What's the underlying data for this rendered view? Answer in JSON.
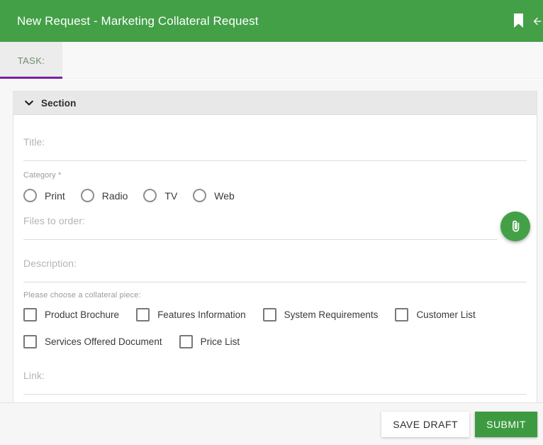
{
  "appbar": {
    "title": "New Request - Marketing Collateral Request",
    "background": "#43a047",
    "icons": [
      {
        "name": "bookmark-icon",
        "label": "Bookmark"
      },
      {
        "name": "back-arrow-icon",
        "label": "Back"
      }
    ]
  },
  "tabs": [
    {
      "label": "TASK:",
      "active": true,
      "accent": "#7b1fa2"
    }
  ],
  "section": {
    "title": "Section",
    "expanded": true,
    "chevron": "chevron-down-icon"
  },
  "fields": {
    "title": {
      "label": "Title:",
      "value": ""
    },
    "category": {
      "label": "Category *",
      "required": true,
      "options": [
        "Print",
        "Radio",
        "TV",
        "Web"
      ],
      "selected": ""
    },
    "files_to_order": {
      "label": "Files to order:",
      "value": ""
    },
    "description": {
      "label": "Description:",
      "value": ""
    },
    "collateral": {
      "label": "Please choose a collateral piece:",
      "row1": [
        "Product Brochure",
        "Features Information",
        "System Requirements",
        "Customer List"
      ],
      "row2": [
        "Services Offered Document",
        "Price List"
      ],
      "checked": []
    },
    "link": {
      "label": "Link:",
      "value": ""
    }
  },
  "attach": {
    "name": "attachment-icon",
    "color": "#43a047"
  },
  "footer": {
    "save_draft_label": "SAVE DRAFT",
    "submit_label": "SUBMIT",
    "submit_color": "#3d9a40"
  }
}
